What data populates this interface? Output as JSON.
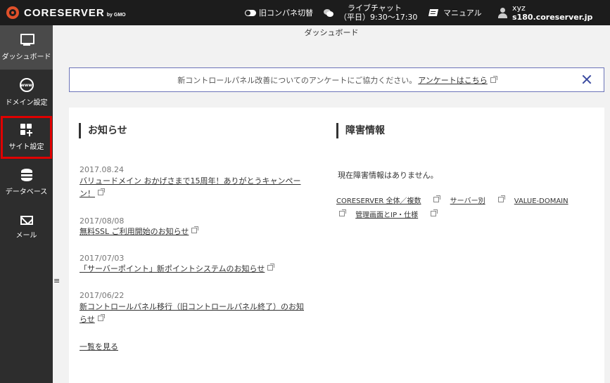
{
  "topbar": {
    "logo": "CORESERVER",
    "logo_sub": "by GMO",
    "old_panel_toggle": "旧コンパネ切替",
    "live_chat_title": "ライブチャット",
    "live_chat_hours": "（平日）9:30～17:30",
    "manual": "マニュアル",
    "user_name": "xyz",
    "server_name": "s180.coreserver.jp"
  },
  "sidebar": {
    "items": [
      {
        "label": "ダッシュボード",
        "icon": "monitor-icon",
        "active": true
      },
      {
        "label": "ドメイン設定",
        "icon": "www-icon"
      },
      {
        "label": "サイト設定",
        "icon": "grid-plus-icon",
        "highlighted": true
      },
      {
        "label": "データベース",
        "icon": "database-icon"
      },
      {
        "label": "メール",
        "icon": "mail-icon"
      }
    ],
    "www_text": "www",
    "collapse_glyph": "≡"
  },
  "breadcrumb": "ダッシュボード",
  "notice": {
    "text": "新コントロールパネル改善についてのアンケートにご協力ください。",
    "link": "アンケートはこちら"
  },
  "news": {
    "title": "お知らせ",
    "items": [
      {
        "date": "2017.08.24",
        "line1": "バリュードメイン おかげさまで15周年！ありがとうキャンペー",
        "line2": "ン！"
      },
      {
        "date": "2017/08/08",
        "line1": "無料SSL ご利用開始のお知らせ",
        "line2": ""
      },
      {
        "date": "2017/07/03",
        "line1": "「サーバーポイント」新ポイントシステムのお知らせ",
        "line2": ""
      },
      {
        "date": "2017/06/22",
        "line1": "新コントロールパネル移行（旧コントロールパネル終了）のお知",
        "line2": "らせ"
      }
    ],
    "view_all": "一覧を見る"
  },
  "fault": {
    "title": "障害情報",
    "message": "現在障害情報はありません。",
    "links": [
      "CORESERVER 全体／複数",
      "サーバー別",
      "VALUE-DOMAIN",
      "管理画面とIP・仕様"
    ]
  },
  "colors": {
    "topbar": "#1c1c1c",
    "sidebar": "#2d2d2d",
    "brand": "#e0502a",
    "highlight": "#e00000",
    "notice_border": "#6b73b8"
  }
}
